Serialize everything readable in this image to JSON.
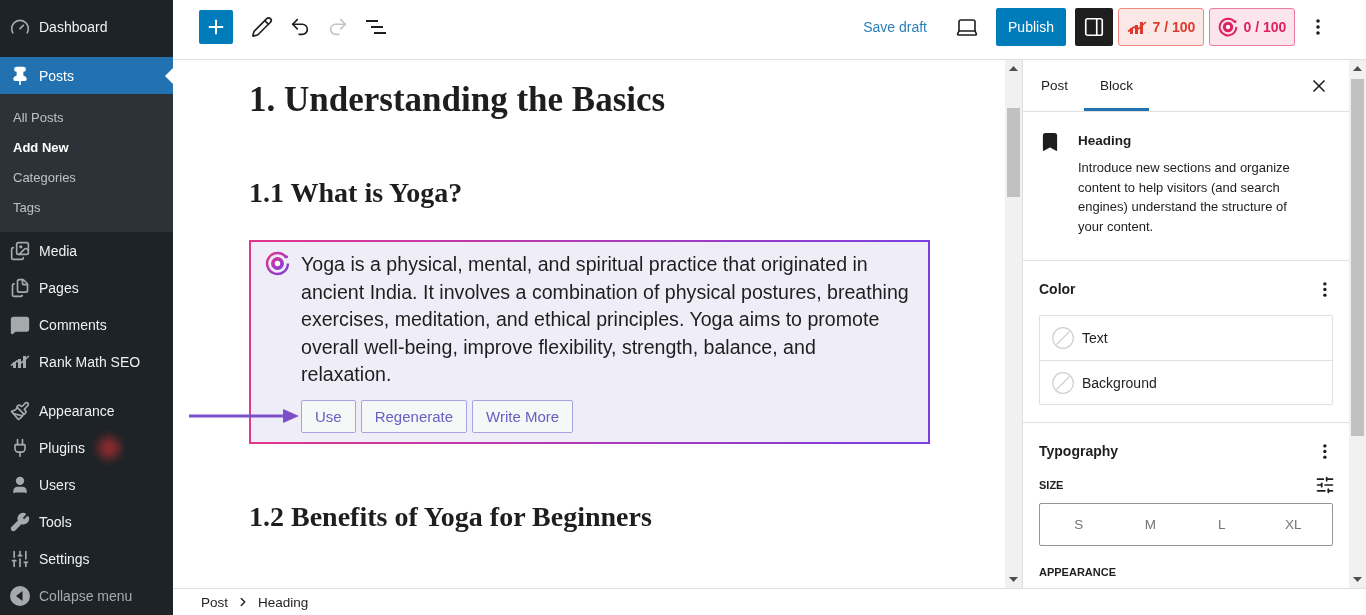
{
  "sidebar": {
    "groups": [
      {
        "items": [
          {
            "label": "Dashboard",
            "selected": false,
            "blurred_badge": false
          }
        ]
      },
      {
        "items": [
          {
            "label": "Posts",
            "selected": true,
            "blurred_badge": false,
            "children": [
              {
                "label": "All Posts",
                "selected": false
              },
              {
                "label": "Add New",
                "selected": true
              },
              {
                "label": "Categories",
                "selected": false
              },
              {
                "label": "Tags",
                "selected": false
              }
            ]
          },
          {
            "label": "Media",
            "selected": false,
            "blurred_badge": false
          },
          {
            "label": "Pages",
            "selected": false,
            "blurred_badge": false
          },
          {
            "label": "Comments",
            "selected": false,
            "blurred_badge": false
          },
          {
            "label": "Rank Math SEO",
            "selected": false,
            "blurred_badge": false
          }
        ]
      },
      {
        "items": [
          {
            "label": "Appearance",
            "selected": false,
            "blurred_badge": false
          },
          {
            "label": "Plugins",
            "selected": false,
            "blurred_badge": true
          },
          {
            "label": "Users",
            "selected": false,
            "blurred_badge": false
          },
          {
            "label": "Tools",
            "selected": false,
            "blurred_badge": false
          },
          {
            "label": "Settings",
            "selected": false,
            "blurred_badge": false
          }
        ]
      }
    ],
    "collapse": "Collapse menu"
  },
  "toolbar": {
    "tools": [
      {
        "disabled": false
      },
      {
        "disabled": false
      },
      {
        "disabled": true
      },
      {
        "disabled": false
      }
    ],
    "save_draft": "Save draft",
    "publish": "Publish",
    "settings_toggle": {
      "pressed": true
    },
    "scores": [
      {
        "value": "7 / 100",
        "color": "#dd3a2e"
      },
      {
        "value": "0 / 100",
        "color": "#df2164"
      }
    ]
  },
  "editor": {
    "blocks": [
      {
        "kind": "h2",
        "text": "1. Understanding the Basics"
      },
      {
        "kind": "h3",
        "text": "1.1 What is Yoga?"
      },
      {
        "kind": "ai_suggestion",
        "text": "Yoga is a physical, mental, and spiritual practice that originated in ancient India. It involves a combination of physical postures, breathing exercises, meditation, and ethical principles. Yoga aims to promote overall well-being, improve flexibility, strength, balance, and relaxation.",
        "actions": [
          {
            "label": "Use",
            "pointed": true
          },
          {
            "label": "Regenerate",
            "pointed": false
          },
          {
            "label": "Write More",
            "pointed": false
          }
        ]
      },
      {
        "kind": "h3",
        "text": "1.2 Benefits of Yoga for Beginners"
      }
    ]
  },
  "panel": {
    "tabs": [
      {
        "label": "Post",
        "selected": false
      },
      {
        "label": "Block",
        "selected": true
      }
    ],
    "block_card": {
      "title": "Heading",
      "description": "Introduce new sections and organize content to help visitors (and search engines) understand the structure of your content."
    },
    "color": {
      "title": "Color",
      "items": [
        {
          "label": "Text"
        },
        {
          "label": "Background"
        }
      ]
    },
    "typography": {
      "title": "Typography",
      "size_label": "SIZE",
      "sizes": [
        {
          "label": "S",
          "selected": false
        },
        {
          "label": "M",
          "selected": false
        },
        {
          "label": "L",
          "selected": false
        },
        {
          "label": "XL",
          "selected": false
        }
      ],
      "appearance_label": "APPEARANCE"
    }
  },
  "footer": {
    "breadcrumbs": [
      "Post",
      "Heading"
    ]
  }
}
